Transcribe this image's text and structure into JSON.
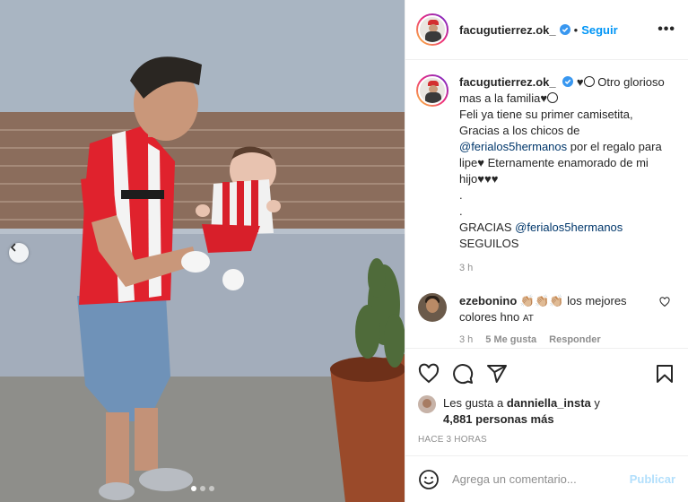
{
  "post": {
    "author": "facugutierrez.ok_",
    "follow_label": "Seguir",
    "more_label": "•••",
    "caption": {
      "username": "facugutierrez.ok_",
      "line1_tail": "Otro glorioso mas a la familia",
      "line2": "Feli ya tiene su primer camisetita, Gracias a los chicos de",
      "mention1": "@ferialos5hermanos",
      "line3": "por el regalo para lipe",
      "line4": "Eternamente enamorado de mi hijo",
      "dot1": ".",
      "dot2": ".",
      "thanks": "GRACIAS",
      "mention2": "@ferialos5hermanos",
      "follow_them": "SEGUILOS",
      "time": "3 h"
    },
    "comment": {
      "username": "ezebonino",
      "emojis": "👏🏼👏🏼👏🏼",
      "text": "los mejores colores hno",
      "at": "AT",
      "time": "3 h",
      "likes": "5 Me gusta",
      "reply": "Responder"
    },
    "likes": {
      "prefix": "Les gusta a",
      "user": "danniella_insta",
      "conj": "y",
      "others": "4,881 personas más"
    },
    "timestamp": "HACE 3 HORAS",
    "input_placeholder": "Agrega un comentario...",
    "publish_label": "Publicar"
  },
  "icons": {
    "verified": "verified-badge-icon",
    "like": "heart-icon",
    "comment": "comment-icon",
    "share": "share-icon",
    "save": "bookmark-icon",
    "emoji": "emoji-icon",
    "prev": "chevron-left-icon"
  },
  "colors": {
    "accent": "#0095f6",
    "text": "#262626",
    "muted": "#8e8e8e",
    "publish_disabled": "#b2dffc"
  },
  "carousel": {
    "slides": 3,
    "active": 1
  }
}
